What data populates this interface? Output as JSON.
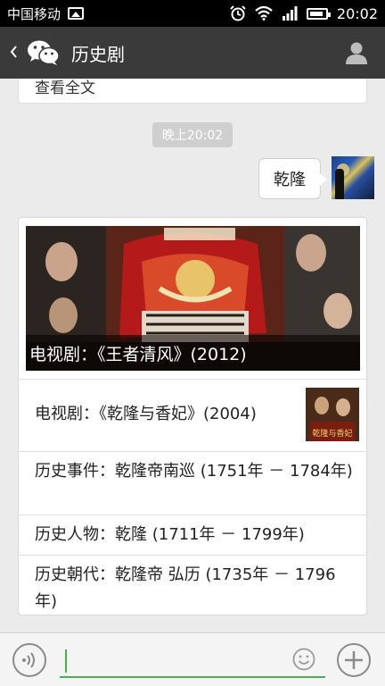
{
  "status_bar": {
    "carrier": "中国移动",
    "time": "20:02"
  },
  "title_bar": {
    "title": "历史剧"
  },
  "chat": {
    "previous_card_text": "查看全文",
    "timestamp": "晚上20:02",
    "user_message": "乾隆",
    "news": {
      "cover_caption": "电视剧：《王者清风》(2012)",
      "items": [
        {
          "text": "电视剧：《乾隆与香妃》(2004)",
          "thumb_caption": "乾隆与香妃"
        },
        {
          "text": "历史事件：乾隆帝南巡 (1751年 － 1784年)"
        },
        {
          "text": "历史人物：乾隆 (1711年 － 1799年)"
        },
        {
          "text": "历史朝代：乾隆帝 弘历 (1735年 － 1796年)"
        }
      ]
    }
  },
  "input_bar": {
    "accent_color": "#4cb04c"
  },
  "icons": [
    "back-icon",
    "wechat-logo-icon",
    "user-icon",
    "voice-icon",
    "emoji-icon",
    "plus-icon"
  ]
}
